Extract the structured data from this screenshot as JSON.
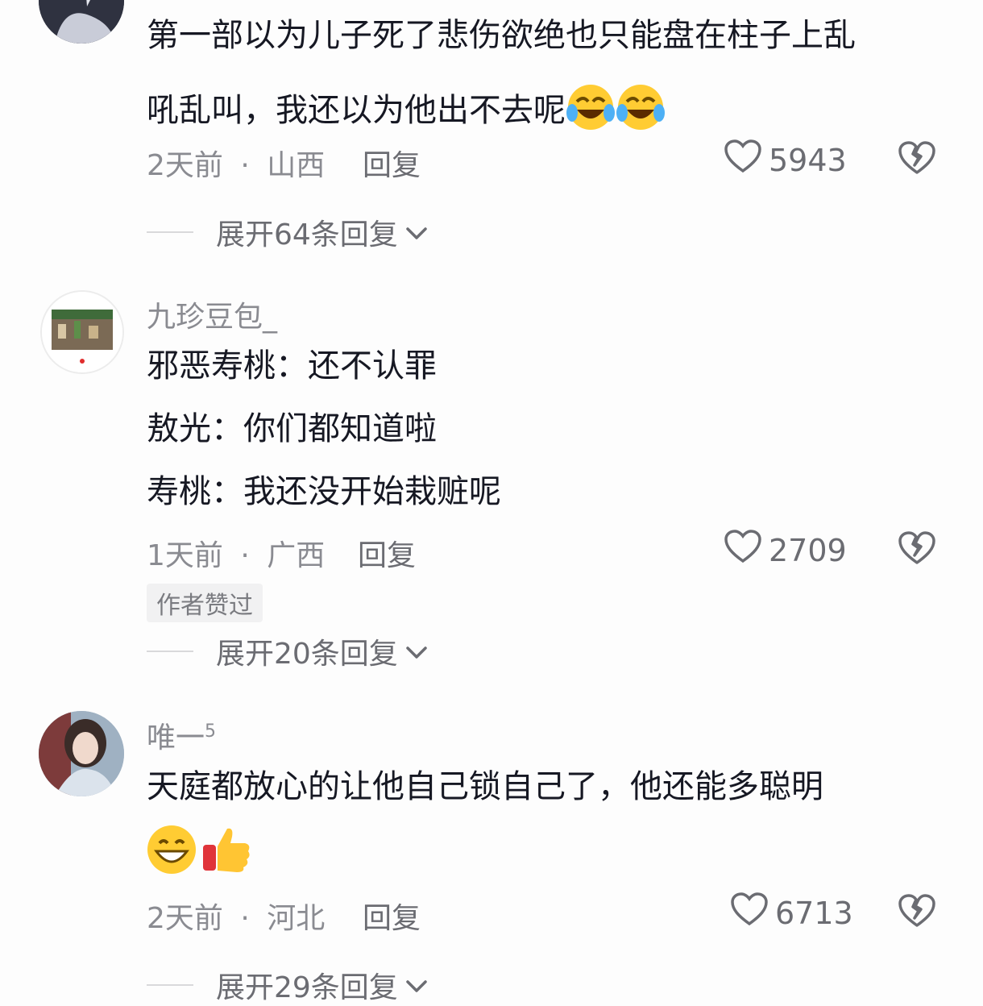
{
  "comments": [
    {
      "text_lines": [
        "第一部以为儿子死了悲伤欲绝也只能盘在柱子上乱",
        "吼乱叫，我还以为他出不去呢"
      ],
      "emojis": [
        "laughing-crying-emoji",
        "laughing-crying-emoji"
      ],
      "time": "2天前",
      "location": "山西",
      "reply_label": "回复",
      "likes": "5943",
      "expand_label": "展开64条回复"
    },
    {
      "username": "九珍豆包_",
      "text_lines": [
        "邪恶寿桃：还不认罪",
        "敖光：你们都知道啦",
        "寿桃：我还没开始栽赃呢"
      ],
      "time": "1天前",
      "location": "广西",
      "reply_label": "回复",
      "likes": "2709",
      "badge": "作者赞过",
      "expand_label": "展开20条回复"
    },
    {
      "username": "唯一",
      "username_sup": "5",
      "text_lines": [
        "天庭都放心的让他自己锁自己了，他还能多聪明"
      ],
      "emojis": [
        "grinning-emoji",
        "thumbs-up-emoji"
      ],
      "time": "2天前",
      "location": "河北",
      "reply_label": "回复",
      "likes": "6713",
      "expand_label": "展开29条回复"
    }
  ],
  "separator": "·",
  "colors": {
    "secondary_text": "#8a8b91",
    "primary_text": "#161823",
    "divider": "#d9d9db"
  }
}
